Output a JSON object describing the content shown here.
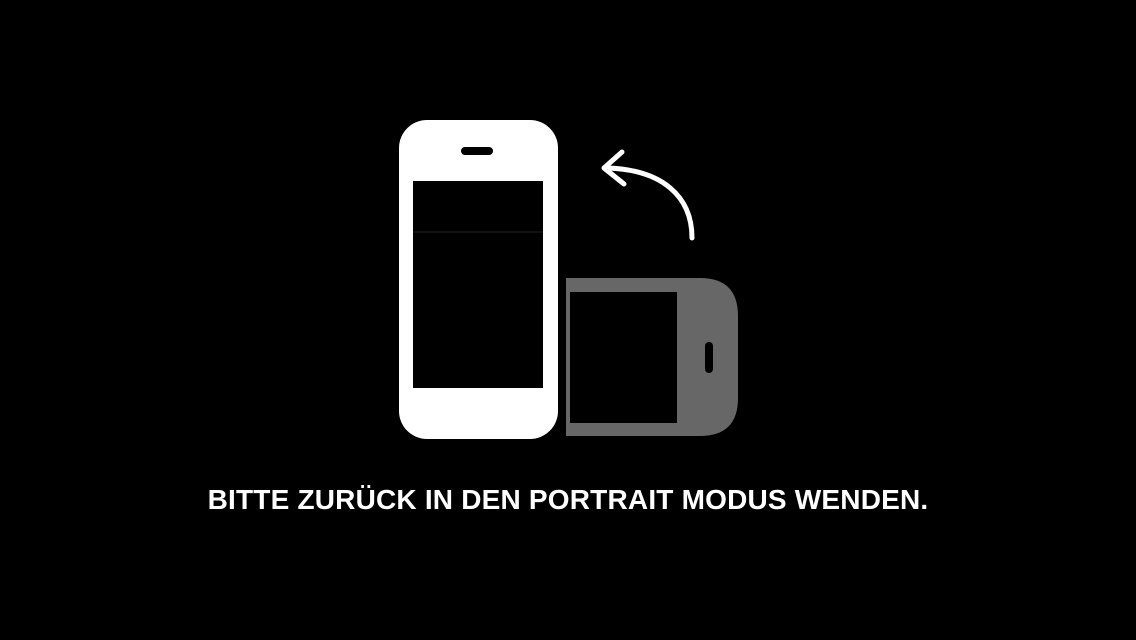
{
  "overlay": {
    "message": "BITTE ZURÜCK IN DEN PORTRAIT MODUS WENDEN."
  },
  "icons": {
    "portrait_phone": "portrait-phone-icon",
    "landscape_phone": "landscape-phone-icon",
    "rotate_arrow": "rotate-arrow-icon"
  },
  "colors": {
    "background": "#000000",
    "foreground": "#ffffff",
    "landscape_phone": "#676767"
  }
}
